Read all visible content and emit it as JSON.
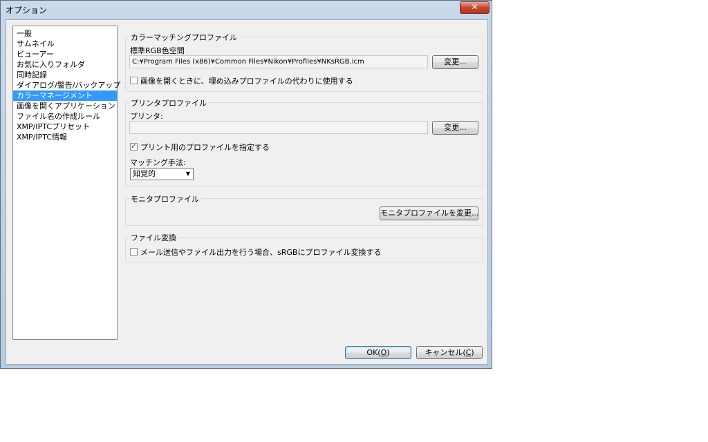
{
  "window": {
    "title": "オプション",
    "close_label": "✕"
  },
  "sidebar": {
    "items": [
      {
        "label": "一般"
      },
      {
        "label": "サムネイル"
      },
      {
        "label": "ビューアー"
      },
      {
        "label": "お気に入りフォルダ"
      },
      {
        "label": "同時記録"
      },
      {
        "label": "ダイアログ/警告/バックアップ"
      },
      {
        "label": "カラーマネージメント",
        "selected": true
      },
      {
        "label": "画像を開くアプリケーション"
      },
      {
        "label": "ファイル名の作成ルール"
      },
      {
        "label": "XMP/IPTCプリセット"
      },
      {
        "label": "XMP/IPTC情報"
      }
    ]
  },
  "color_matching": {
    "title": "カラーマッチングプロファイル",
    "field_label": "標準RGB色空間",
    "path": "C:¥Program Files (x86)¥Common Files¥Nikon¥Profiles¥NKsRGB.icm",
    "change_button": "変更...",
    "embedded_checkbox_label": "画像を開くときに、埋め込みプロファイルの代わりに使用する",
    "embedded_checked": false
  },
  "printer_profile": {
    "title": "プリンタプロファイル",
    "printer_label": "プリンタ:",
    "printer_value": "",
    "change_button": "変更...",
    "specify_checkbox_label": "プリント用のプロファイルを指定する",
    "specify_checked": true,
    "matching_label": "マッチング手法:",
    "matching_value": "知覚的"
  },
  "monitor_profile": {
    "title": "モニタプロファイル",
    "change_button": "モニタプロファイルを変更..."
  },
  "file_conversion": {
    "title": "ファイル変換",
    "checkbox_label": "メール送信やファイル出力を行う場合、sRGBにプロファイル変換する",
    "checked": false
  },
  "footer": {
    "ok_label": "OK(",
    "ok_key": "O",
    "ok_suffix": ")",
    "cancel_label": "キャンセル(",
    "cancel_key": "C",
    "cancel_suffix": ")"
  }
}
